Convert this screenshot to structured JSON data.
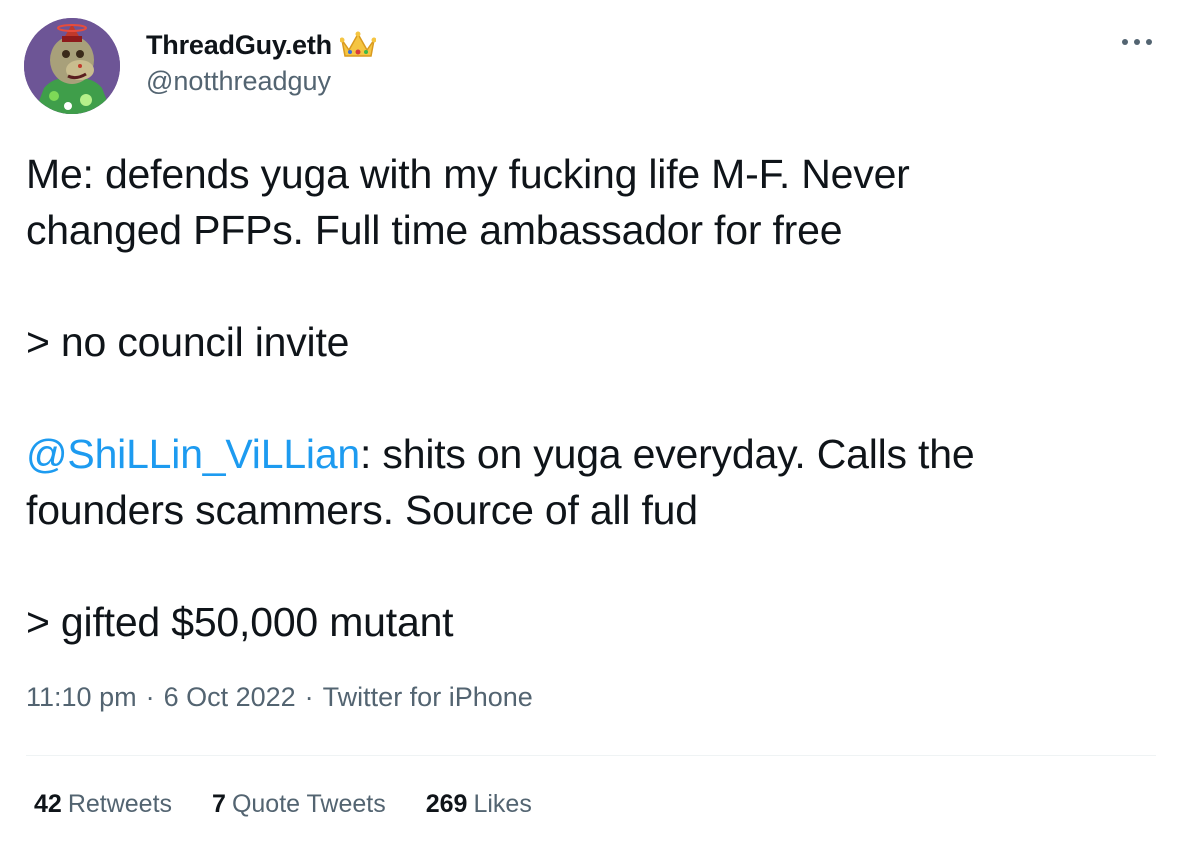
{
  "author": {
    "display_name": "ThreadGuy.eth",
    "handle": "@notthreadguy",
    "badge_icon": "crown-icon",
    "avatar_icon": "ape-nft-avatar"
  },
  "tweet": {
    "line1": "Me: defends yuga with my fucking life M-F. Never",
    "line2": "changed PFPs. Full time ambassador for free",
    "line3": "> no council invite",
    "mention": "@ShiLLin_ViLLian",
    "line4_rest": ": shits on yuga everyday. Calls the",
    "line5": "founders scammers. Source of all fud",
    "line6": "> gifted $50,000 mutant"
  },
  "meta": {
    "time": "11:10 pm",
    "date": "6 Oct 2022",
    "source": "Twitter for iPhone",
    "separator": "·"
  },
  "stats": {
    "retweets_count": "42",
    "retweets_label": "Retweets",
    "quotes_count": "7",
    "quotes_label": "Quote Tweets",
    "likes_count": "269",
    "likes_label": "Likes"
  },
  "colors": {
    "text": "#0f1419",
    "secondary": "#536471",
    "link": "#1d9bf0",
    "divider": "#eff3f4"
  }
}
